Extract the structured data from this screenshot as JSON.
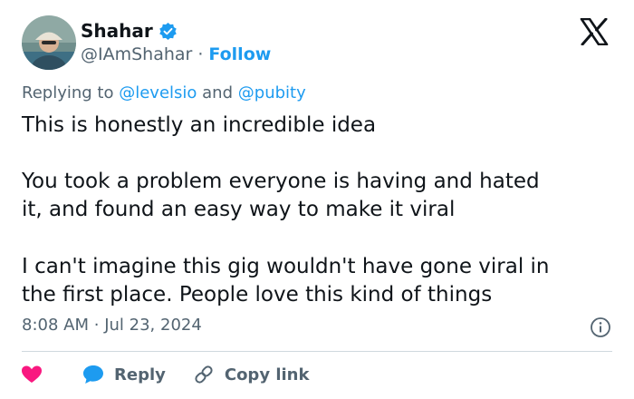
{
  "author": {
    "name": "Shahar",
    "handle": "@IAmShahar",
    "separator": "·",
    "follow_label": "Follow"
  },
  "reply_context": {
    "prefix": "Replying to",
    "mentions": [
      "@levelsio",
      "@pubity"
    ],
    "conjunction": "and"
  },
  "tweet": {
    "lines": [
      "This is honestly an incredible idea",
      "You took a problem everyone is having and hated",
      "it, and found an easy way to make it viral",
      "I can't imagine this gig wouldn't have gone viral in",
      "the first place. People love this kind of things"
    ],
    "time": "8:08 AM",
    "date": "Jul 23, 2024",
    "separator": "·"
  },
  "actions": {
    "reply_label": "Reply",
    "copy_link_label": "Copy link"
  },
  "icons": {
    "verified": "verified-badge-icon",
    "x_logo": "x-logo-icon",
    "info": "info-icon",
    "like": "heart-icon",
    "reply": "speech-bubble-icon",
    "copy_link": "link-icon"
  },
  "colors": {
    "accent": "#1d9bf0",
    "like": "#f91880",
    "text": "#0f1419",
    "muted": "#536471",
    "divider": "#cfd9de"
  }
}
